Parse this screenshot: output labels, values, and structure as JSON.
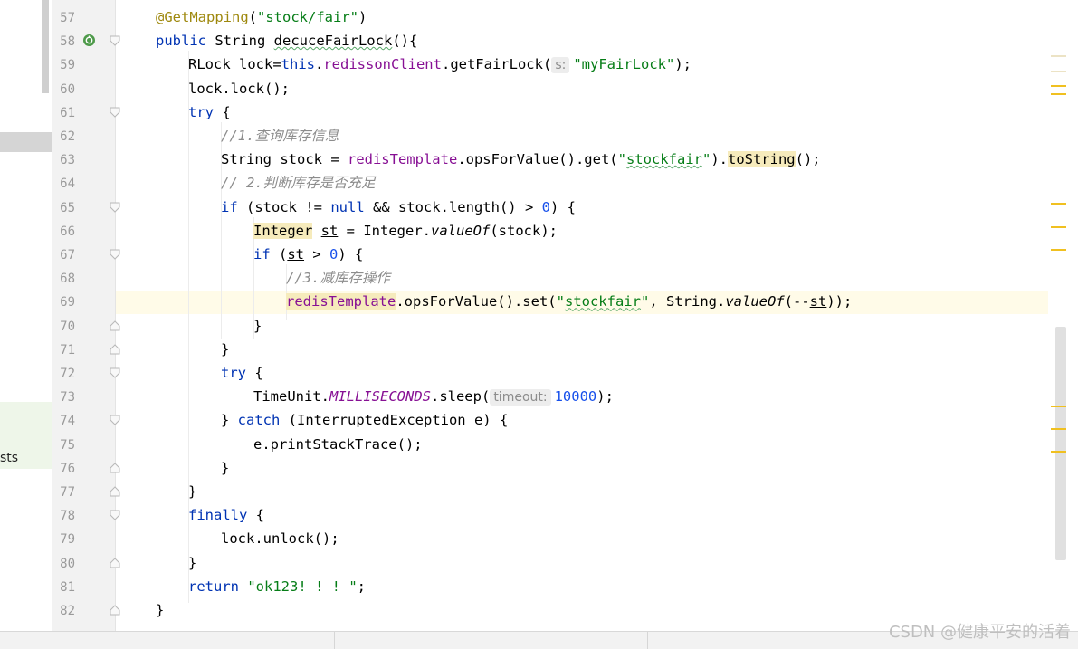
{
  "project_panel": {
    "visible_item_label": "sts"
  },
  "gutter": {
    "line_numbers": [
      "57",
      "58",
      "59",
      "60",
      "61",
      "62",
      "63",
      "64",
      "65",
      "66",
      "67",
      "68",
      "69",
      "70",
      "71",
      "72",
      "73",
      "74",
      "75",
      "76",
      "77",
      "78",
      "79",
      "80",
      "81",
      "82"
    ],
    "icons": {
      "spring_mapping": "spring-web-mapping-icon",
      "fold": "fold-arrow-icon"
    }
  },
  "editor": {
    "current_line": "69",
    "param_hints": {
      "getFairLock": "s:",
      "sleep": "timeout:"
    }
  },
  "main": {
    "code_lines": [
      {
        "line": "57",
        "text": "@GetMapping(\"stock/fair\")"
      },
      {
        "line": "58",
        "text": "public String decuceFairLock(){"
      },
      {
        "line": "59",
        "text": "RLock lock=this.redissonClient.getFairLock( \"myFairLock\");"
      },
      {
        "line": "60",
        "text": "lock.lock();"
      },
      {
        "line": "61",
        "text": "try {"
      },
      {
        "line": "62",
        "text": "//1.查询库存信息"
      },
      {
        "line": "63",
        "text": "String stock = redisTemplate.opsForValue().get(\"stockfair\").toString();"
      },
      {
        "line": "64",
        "text": "// 2.判断库存是否充足"
      },
      {
        "line": "65",
        "text": "if (stock != null && stock.length() > 0) {"
      },
      {
        "line": "66",
        "text": "Integer st = Integer.valueOf(stock);"
      },
      {
        "line": "67",
        "text": "if (st > 0) {"
      },
      {
        "line": "68",
        "text": "//3.减库存操作"
      },
      {
        "line": "69",
        "text": "redisTemplate.opsForValue().set(\"stockfair\", String.valueOf(--st));"
      },
      {
        "line": "70",
        "text": "}"
      },
      {
        "line": "71",
        "text": "}"
      },
      {
        "line": "72",
        "text": "try {"
      },
      {
        "line": "73",
        "text": "TimeUnit.MILLISECONDS.sleep( 10000);"
      },
      {
        "line": "74",
        "text": "} catch (InterruptedException e) {"
      },
      {
        "line": "75",
        "text": "e.printStackTrace();"
      },
      {
        "line": "76",
        "text": "}"
      },
      {
        "line": "77",
        "text": "}"
      },
      {
        "line": "78",
        "text": "finally {"
      },
      {
        "line": "79",
        "text": "lock.unlock();"
      },
      {
        "line": "80",
        "text": "}"
      },
      {
        "line": "81",
        "text": "return \"ok123! ! ! \";"
      },
      {
        "line": "82",
        "text": "}"
      }
    ]
  },
  "tokens": {
    "l57": {
      "ann": "@GetMapping",
      "p1": "(",
      "s1": "\"stock/fair\"",
      "p2": ")"
    },
    "l58": {
      "kw": "public",
      "t1": " String ",
      "name": "decuceFairLock",
      "t2": "(){"
    },
    "l59": {
      "t1": "RLock lock=",
      "kw": "this",
      "dot": ".",
      "field": "redissonClient",
      "t2": ".getFairLock(",
      "s1": "\"myFairLock\"",
      "t3": ");"
    },
    "l60": {
      "t1": "lock.lock();"
    },
    "l61": {
      "kw": "try",
      "t1": " {"
    },
    "l62": {
      "c1": "//1.",
      "c2": "查询库存信息"
    },
    "l63": {
      "t1": "String stock = ",
      "field": "redisTemplate",
      "t2": ".opsForValue().get(",
      "q1": "\"",
      "s1": "stockfair",
      "q2": "\"",
      "t3": ").",
      "m": "toString",
      "t4": "();"
    },
    "l64": {
      "c1": "// 2.",
      "c2": "判断库存是否充足"
    },
    "l65": {
      "kw1": "if",
      "t1": " (stock != ",
      "kw2": "null",
      "t2": " && stock.length() > ",
      "n1": "0",
      "t3": ") {"
    },
    "l66": {
      "type": "Integer",
      "t1": " ",
      "var": "st",
      "t2": " = Integer.",
      "m": "valueOf",
      "t3": "(stock);"
    },
    "l67": {
      "kw": "if",
      "t1": " (",
      "var": "st",
      "t2": " > ",
      "n1": "0",
      "t3": ") {"
    },
    "l68": {
      "c1": "//3.",
      "c2": "减库存操作"
    },
    "l69": {
      "field": "redisTemplate",
      "t1": ".opsForValue().set(",
      "q1": "\"",
      "s1": "stockfair",
      "q2": "\"",
      "t2": ", String.",
      "m": "valueOf",
      "t3": "(--",
      "var": "st",
      "t4": "));"
    },
    "l70": {
      "t1": "}"
    },
    "l71": {
      "t1": "}"
    },
    "l72": {
      "kw": "try",
      "t1": " {"
    },
    "l73": {
      "t1": "TimeUnit.",
      "const": "MILLISECONDS",
      "t2": ".sleep(",
      "n1": "10000",
      "t3": ");"
    },
    "l74": {
      "t1": "} ",
      "kw": "catch",
      "t2": " (InterruptedException e) {"
    },
    "l75": {
      "t1": "e.printStackTrace();"
    },
    "l76": {
      "t1": "}"
    },
    "l77": {
      "t1": "}"
    },
    "l78": {
      "kw": "finally",
      "t1": " {"
    },
    "l79": {
      "t1": "lock.unlock();"
    },
    "l80": {
      "t1": "}"
    },
    "l81": {
      "kw": "return",
      "t1": " ",
      "s1": "\"ok123! ! ! \"",
      "t2": ";"
    },
    "l82": {
      "t1": "}"
    }
  },
  "colors": {
    "keyword": "#0033b3",
    "annotation": "#9e880d",
    "string": "#067d17",
    "number": "#1750eb",
    "field": "#871094",
    "comment": "#8c8c8c",
    "current_line_bg": "#fffbe8",
    "marker": "#f0c020"
  },
  "watermark": {
    "text": "CSDN @健康平安的活着"
  }
}
